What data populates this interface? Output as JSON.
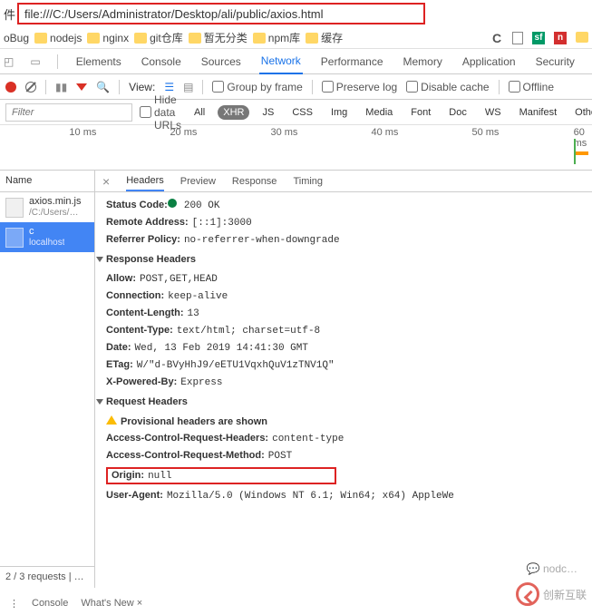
{
  "url_bar": {
    "prefix": "件",
    "value": "file:///C:/Users/Administrator/Desktop/ali/public/axios.html"
  },
  "bookmarks": [
    "oBug",
    "nodejs",
    "nginx",
    "git仓库",
    "暂无分类",
    "npm库",
    "缓存"
  ],
  "right_icons": {
    "c_glyph": "C"
  },
  "devtools_tabs": [
    "Elements",
    "Console",
    "Sources",
    "Network",
    "Performance",
    "Memory",
    "Application",
    "Security"
  ],
  "devtools_active": "Network",
  "toolbar": {
    "view_label": "View:",
    "group_by_frame": "Group by frame",
    "preserve_log": "Preserve log",
    "disable_cache": "Disable cache",
    "offline": "Offline"
  },
  "filter_row": {
    "placeholder": "Filter",
    "hide_data_urls": "Hide data URLs",
    "types": [
      "All",
      "XHR",
      "JS",
      "CSS",
      "Img",
      "Media",
      "Font",
      "Doc",
      "WS",
      "Manifest",
      "Other"
    ],
    "active_type": "XHR"
  },
  "timeline_ticks": [
    "10 ms",
    "20 ms",
    "30 ms",
    "40 ms",
    "50 ms",
    "60 ms"
  ],
  "name_col": {
    "header": "Name",
    "requests": [
      {
        "name": "axios.min.js",
        "sub": "/C:/Users/…",
        "selected": false
      },
      {
        "name": "c",
        "sub": "localhost",
        "selected": true
      }
    ]
  },
  "detail_tabs": [
    "Headers",
    "Preview",
    "Response",
    "Timing"
  ],
  "detail_tab_active": "Headers",
  "general": {
    "status_code": {
      "k": "Status Code:",
      "v": "200 OK"
    },
    "remote_address": {
      "k": "Remote Address:",
      "v": "[::1]:3000"
    },
    "referrer_policy": {
      "k": "Referrer Policy:",
      "v": "no-referrer-when-downgrade"
    }
  },
  "response_headers_title": "Response Headers",
  "response_headers": [
    {
      "k": "Allow:",
      "v": "POST,GET,HEAD"
    },
    {
      "k": "Connection:",
      "v": "keep-alive"
    },
    {
      "k": "Content-Length:",
      "v": "13"
    },
    {
      "k": "Content-Type:",
      "v": "text/html; charset=utf-8"
    },
    {
      "k": "Date:",
      "v": "Wed, 13 Feb 2019 14:41:30 GMT"
    },
    {
      "k": "ETag:",
      "v": "W/\"d-BVyHhJ9/eETU1VqxhQuV1zTNV1Q\""
    },
    {
      "k": "X-Powered-By:",
      "v": "Express"
    }
  ],
  "request_headers_title": "Request Headers",
  "provisional": "Provisional headers are shown",
  "request_headers": [
    {
      "k": "Access-Control-Request-Headers:",
      "v": "content-type"
    },
    {
      "k": "Access-Control-Request-Method:",
      "v": "POST"
    },
    {
      "k": "Origin:",
      "v": "null",
      "highlight": true
    },
    {
      "k": "User-Agent:",
      "v": "Mozilla/5.0 (Windows NT 6.1; Win64; x64) AppleWe"
    }
  ],
  "status_bar": "2 / 3 requests  | …",
  "bottom": {
    "console": "Console",
    "whatsnew": "What's New ×"
  },
  "watermark": {
    "nodc": "nodc…",
    "brand": "创新互联"
  }
}
